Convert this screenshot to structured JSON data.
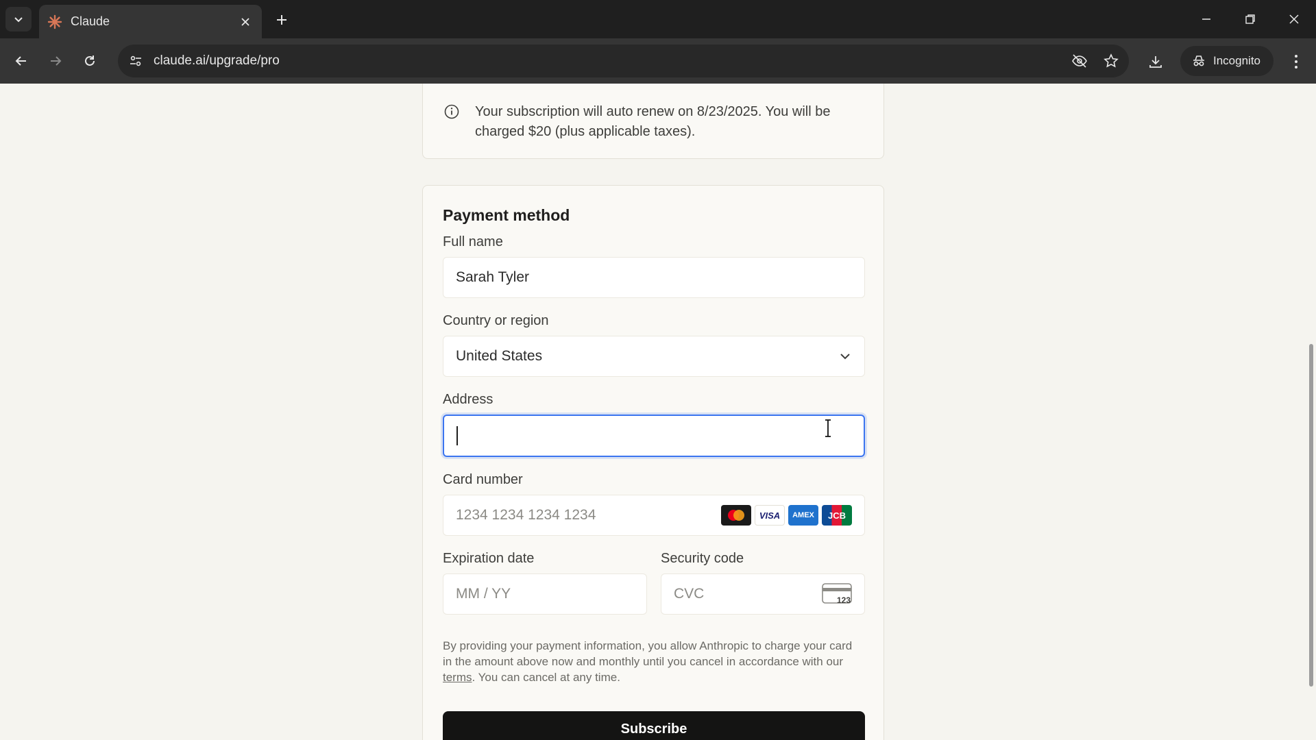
{
  "browser": {
    "tab_title": "Claude",
    "url": "claude.ai/upgrade/pro",
    "incognito_label": "Incognito",
    "brand_color": "#d97757"
  },
  "notice": {
    "text": "Your subscription will auto renew on 8/23/2025. You will be charged $20 (plus applicable taxes)."
  },
  "payment": {
    "heading": "Payment method",
    "full_name": {
      "label": "Full name",
      "value": "Sarah Tyler"
    },
    "country": {
      "label": "Country or region",
      "value": "United States"
    },
    "address": {
      "label": "Address",
      "value": ""
    },
    "card_number": {
      "label": "Card number",
      "placeholder": "1234 1234 1234 1234",
      "brands": [
        "mastercard",
        "VISA",
        "AMEX",
        "JCB"
      ]
    },
    "expiration": {
      "label": "Expiration date",
      "placeholder": "MM / YY"
    },
    "security": {
      "label": "Security code",
      "placeholder": "CVC",
      "icon_text": "123"
    },
    "legal_before": "By providing your payment information, you allow Anthropic to charge your card in the amount above now and monthly until you cancel in accordance with our ",
    "legal_link": "terms",
    "legal_after": ". You can cancel at any time.",
    "subscribe_label": "Subscribe"
  }
}
